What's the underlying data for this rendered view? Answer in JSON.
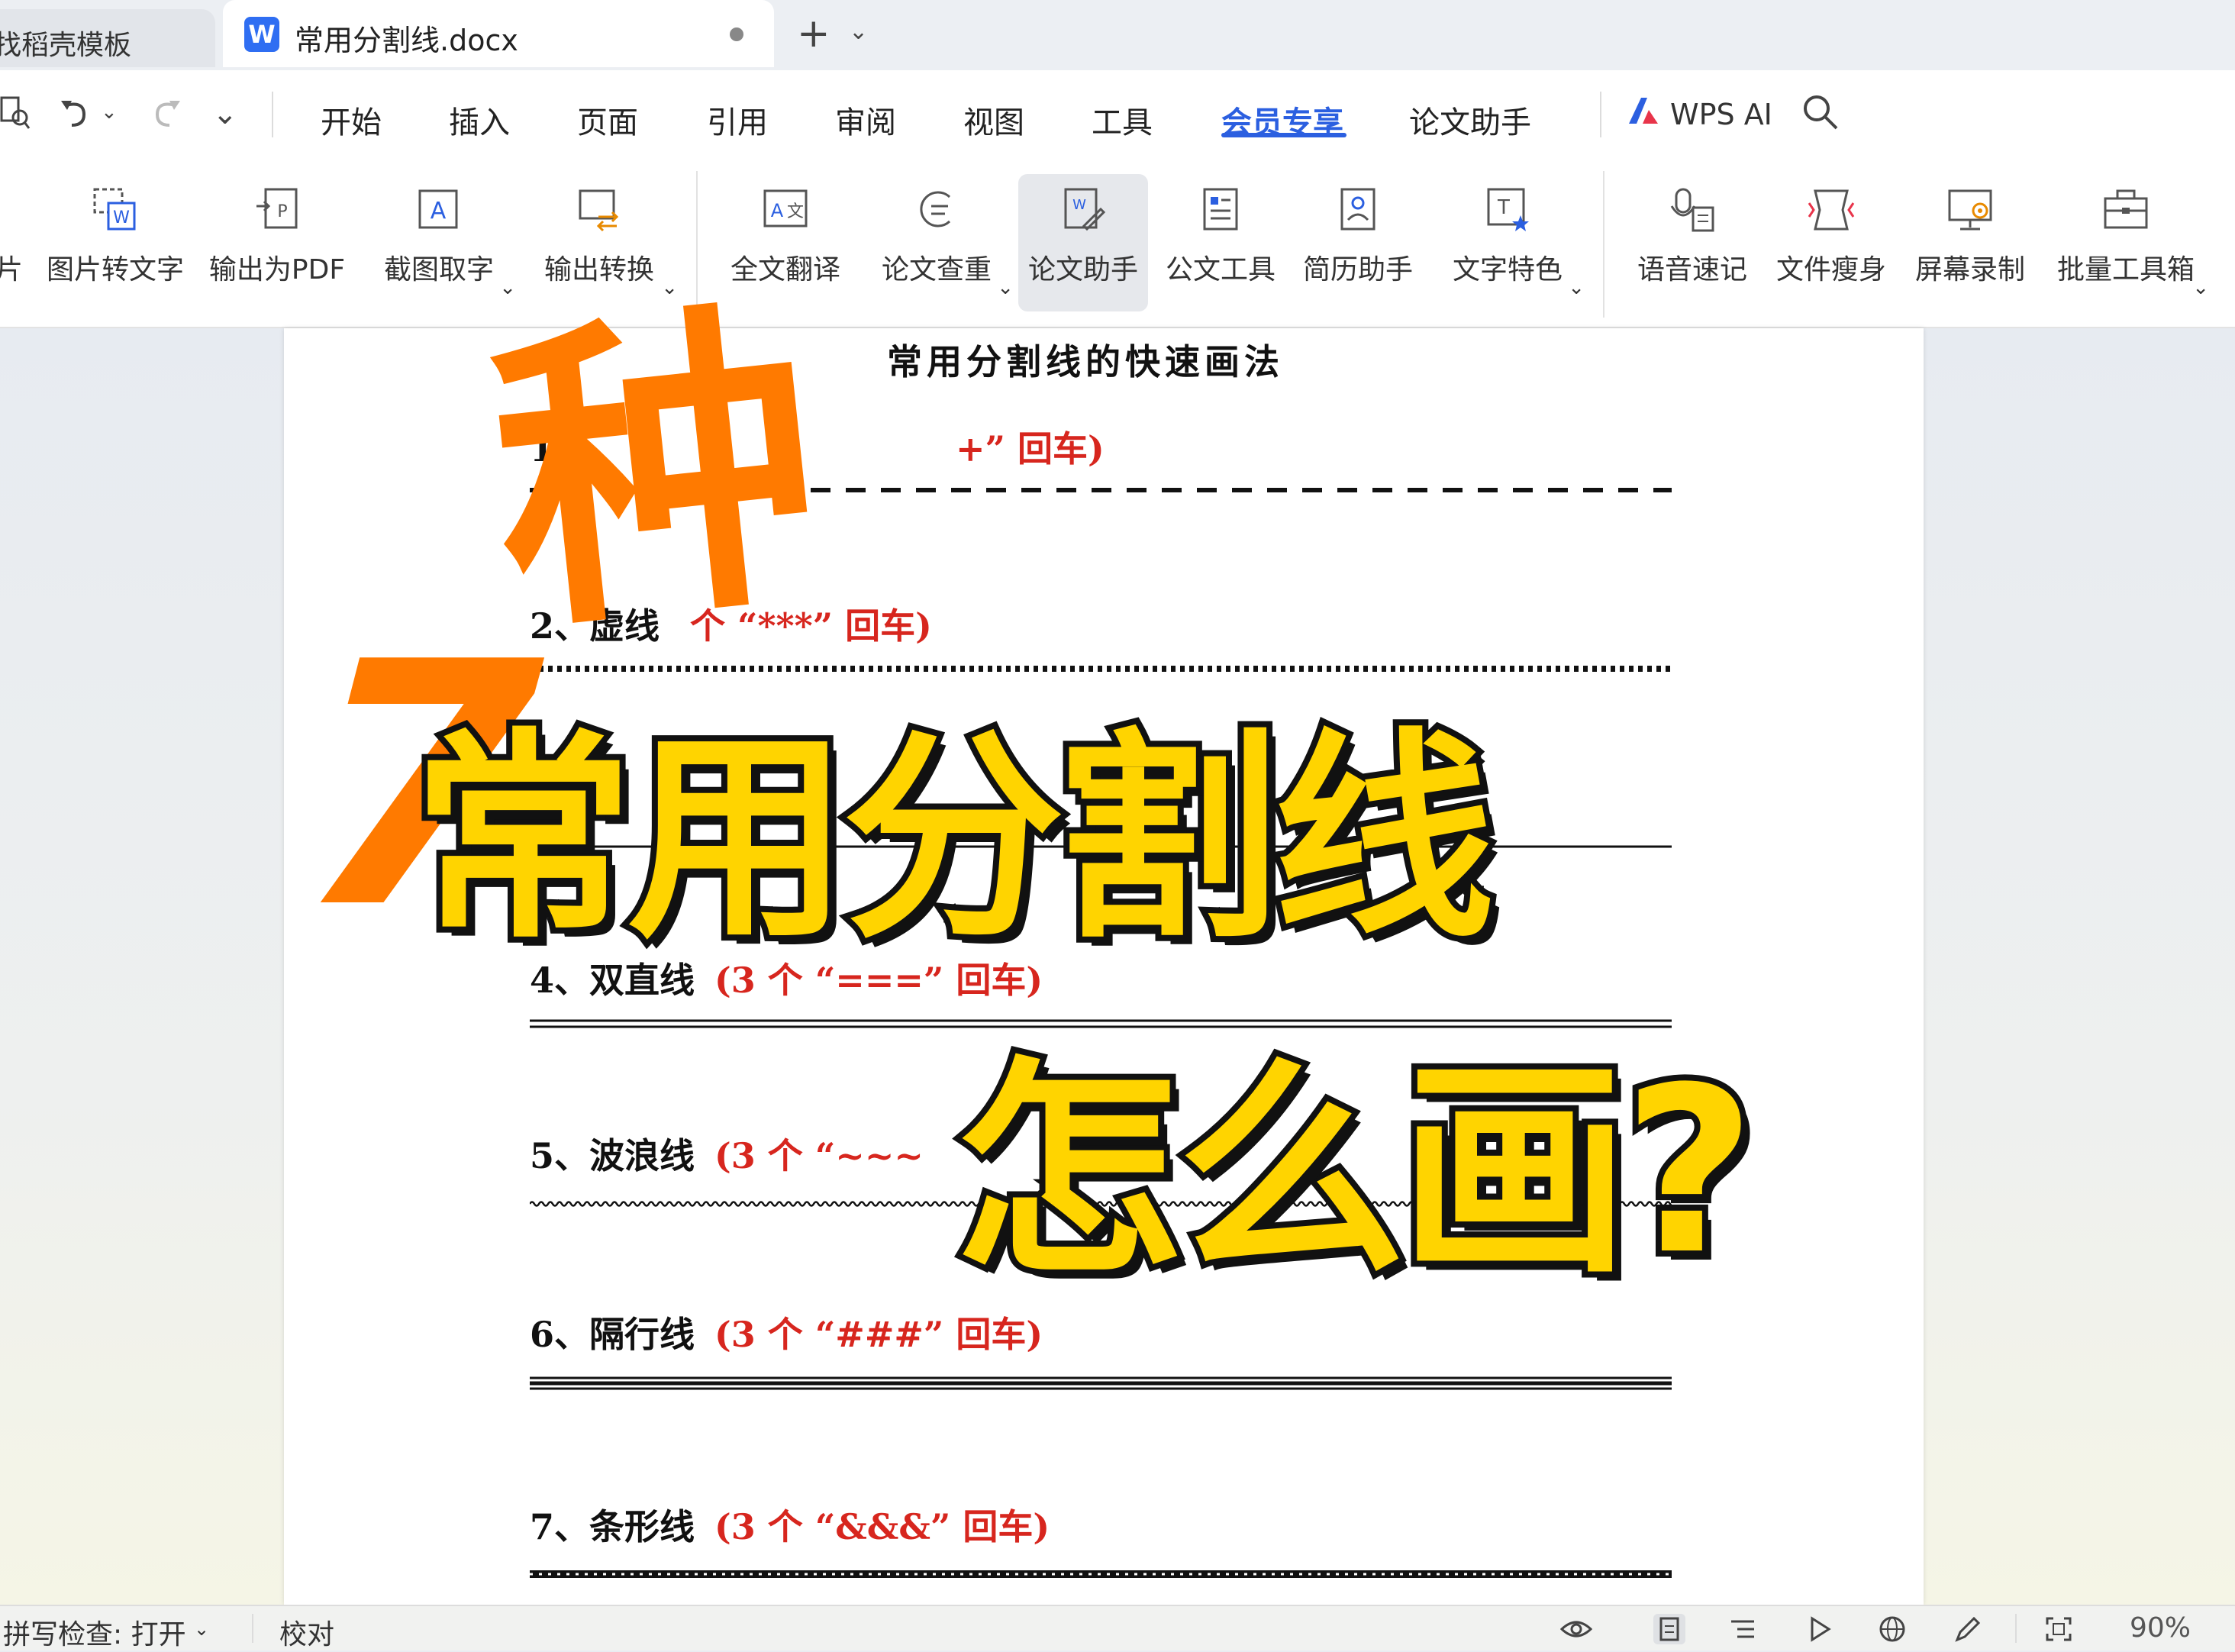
{
  "tabs": {
    "prev_label": "找稻壳模板",
    "active_icon_letter": "W",
    "active_label": "常用分割线.docx"
  },
  "menu": {
    "items": [
      "开始",
      "插入",
      "页面",
      "引用",
      "审阅",
      "视图",
      "工具",
      "会员专享",
      "论文助手"
    ],
    "active": "会员专享",
    "wps_ai": "WPS AI"
  },
  "ribbon": {
    "tools": [
      {
        "label": "片",
        "icon": "picture-icon"
      },
      {
        "label": "图片转文字",
        "icon": "image-to-text-icon"
      },
      {
        "label": "输出为PDF",
        "icon": "export-pdf-icon"
      },
      {
        "label": "截图取字",
        "icon": "screenshot-ocr-icon",
        "dropdown": true
      },
      {
        "label": "输出转换",
        "icon": "convert-icon",
        "dropdown": true
      },
      {
        "label": "全文翻译",
        "icon": "translate-icon"
      },
      {
        "label": "论文查重",
        "icon": "plagiarism-check-icon",
        "dropdown": true
      },
      {
        "label": "论文助手",
        "icon": "paper-assistant-icon"
      },
      {
        "label": "公文工具",
        "icon": "document-tool-icon"
      },
      {
        "label": "简历助手",
        "icon": "resume-icon"
      },
      {
        "label": "文字特色",
        "icon": "text-feature-icon",
        "dropdown": true
      },
      {
        "label": "语音速记",
        "icon": "voice-note-icon"
      },
      {
        "label": "文件瘦身",
        "icon": "file-slim-icon"
      },
      {
        "label": "屏幕录制",
        "icon": "screen-record-icon"
      },
      {
        "label": "批量工具箱",
        "icon": "toolbox-icon",
        "dropdown": true
      }
    ]
  },
  "document": {
    "title": "常用分割线的快速画法",
    "items": [
      {
        "num": "1、",
        "name": "",
        "hint": "+” 回车)"
      },
      {
        "num": "2、",
        "name": "虚线",
        "hint": "个 “***” 回车)"
      },
      {
        "num": "4、",
        "name": "双直线",
        "hint": "(3 个 “===” 回车)"
      },
      {
        "num": "5、",
        "name": "波浪线",
        "hint": "(3 个 “~~~"
      },
      {
        "num": "6、",
        "name": "隔行线",
        "hint": "(3 个 “###” 回车)"
      },
      {
        "num": "7、",
        "name": "条形线",
        "hint": "(3 个 “&&&” 回车)"
      }
    ]
  },
  "overlay": {
    "seven": "7",
    "zhong": "种",
    "line1": "常用分割线",
    "line2": "怎么画?",
    "orange": "#ff7a00",
    "yellow": "#ffd400"
  },
  "status": {
    "spell_check": "拼写检查: 打开",
    "proofread": "校对",
    "zoom": "90%"
  }
}
